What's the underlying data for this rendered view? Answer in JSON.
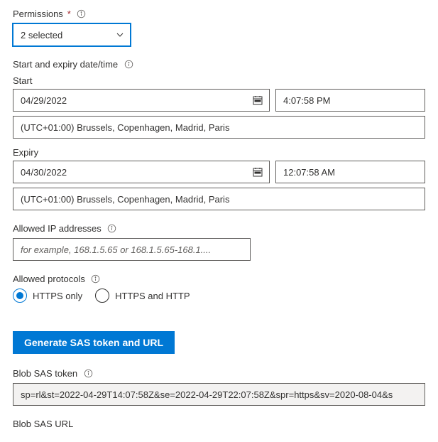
{
  "permissions": {
    "label": "Permissions",
    "selected": "2 selected"
  },
  "datetime_section": {
    "label": "Start and expiry date/time",
    "start_label": "Start",
    "start_date": "04/29/2022",
    "start_time": "4:07:58 PM",
    "start_tz": "(UTC+01:00) Brussels, Copenhagen, Madrid, Paris",
    "expiry_label": "Expiry",
    "expiry_date": "04/30/2022",
    "expiry_time": "12:07:58 AM",
    "expiry_tz": "(UTC+01:00) Brussels, Copenhagen, Madrid, Paris"
  },
  "allowed_ip": {
    "label": "Allowed IP addresses",
    "placeholder": "for example, 168.1.5.65 or 168.1.5.65-168.1...."
  },
  "allowed_protocols": {
    "label": "Allowed protocols",
    "option1": "HTTPS only",
    "option2": "HTTPS and HTTP"
  },
  "button": {
    "generate": "Generate SAS token and URL"
  },
  "sas_token": {
    "label": "Blob SAS token",
    "value": "sp=rl&st=2022-04-29T14:07:58Z&se=2022-04-29T22:07:58Z&spr=https&sv=2020-08-04&s"
  },
  "sas_url": {
    "label": "Blob SAS URL"
  }
}
